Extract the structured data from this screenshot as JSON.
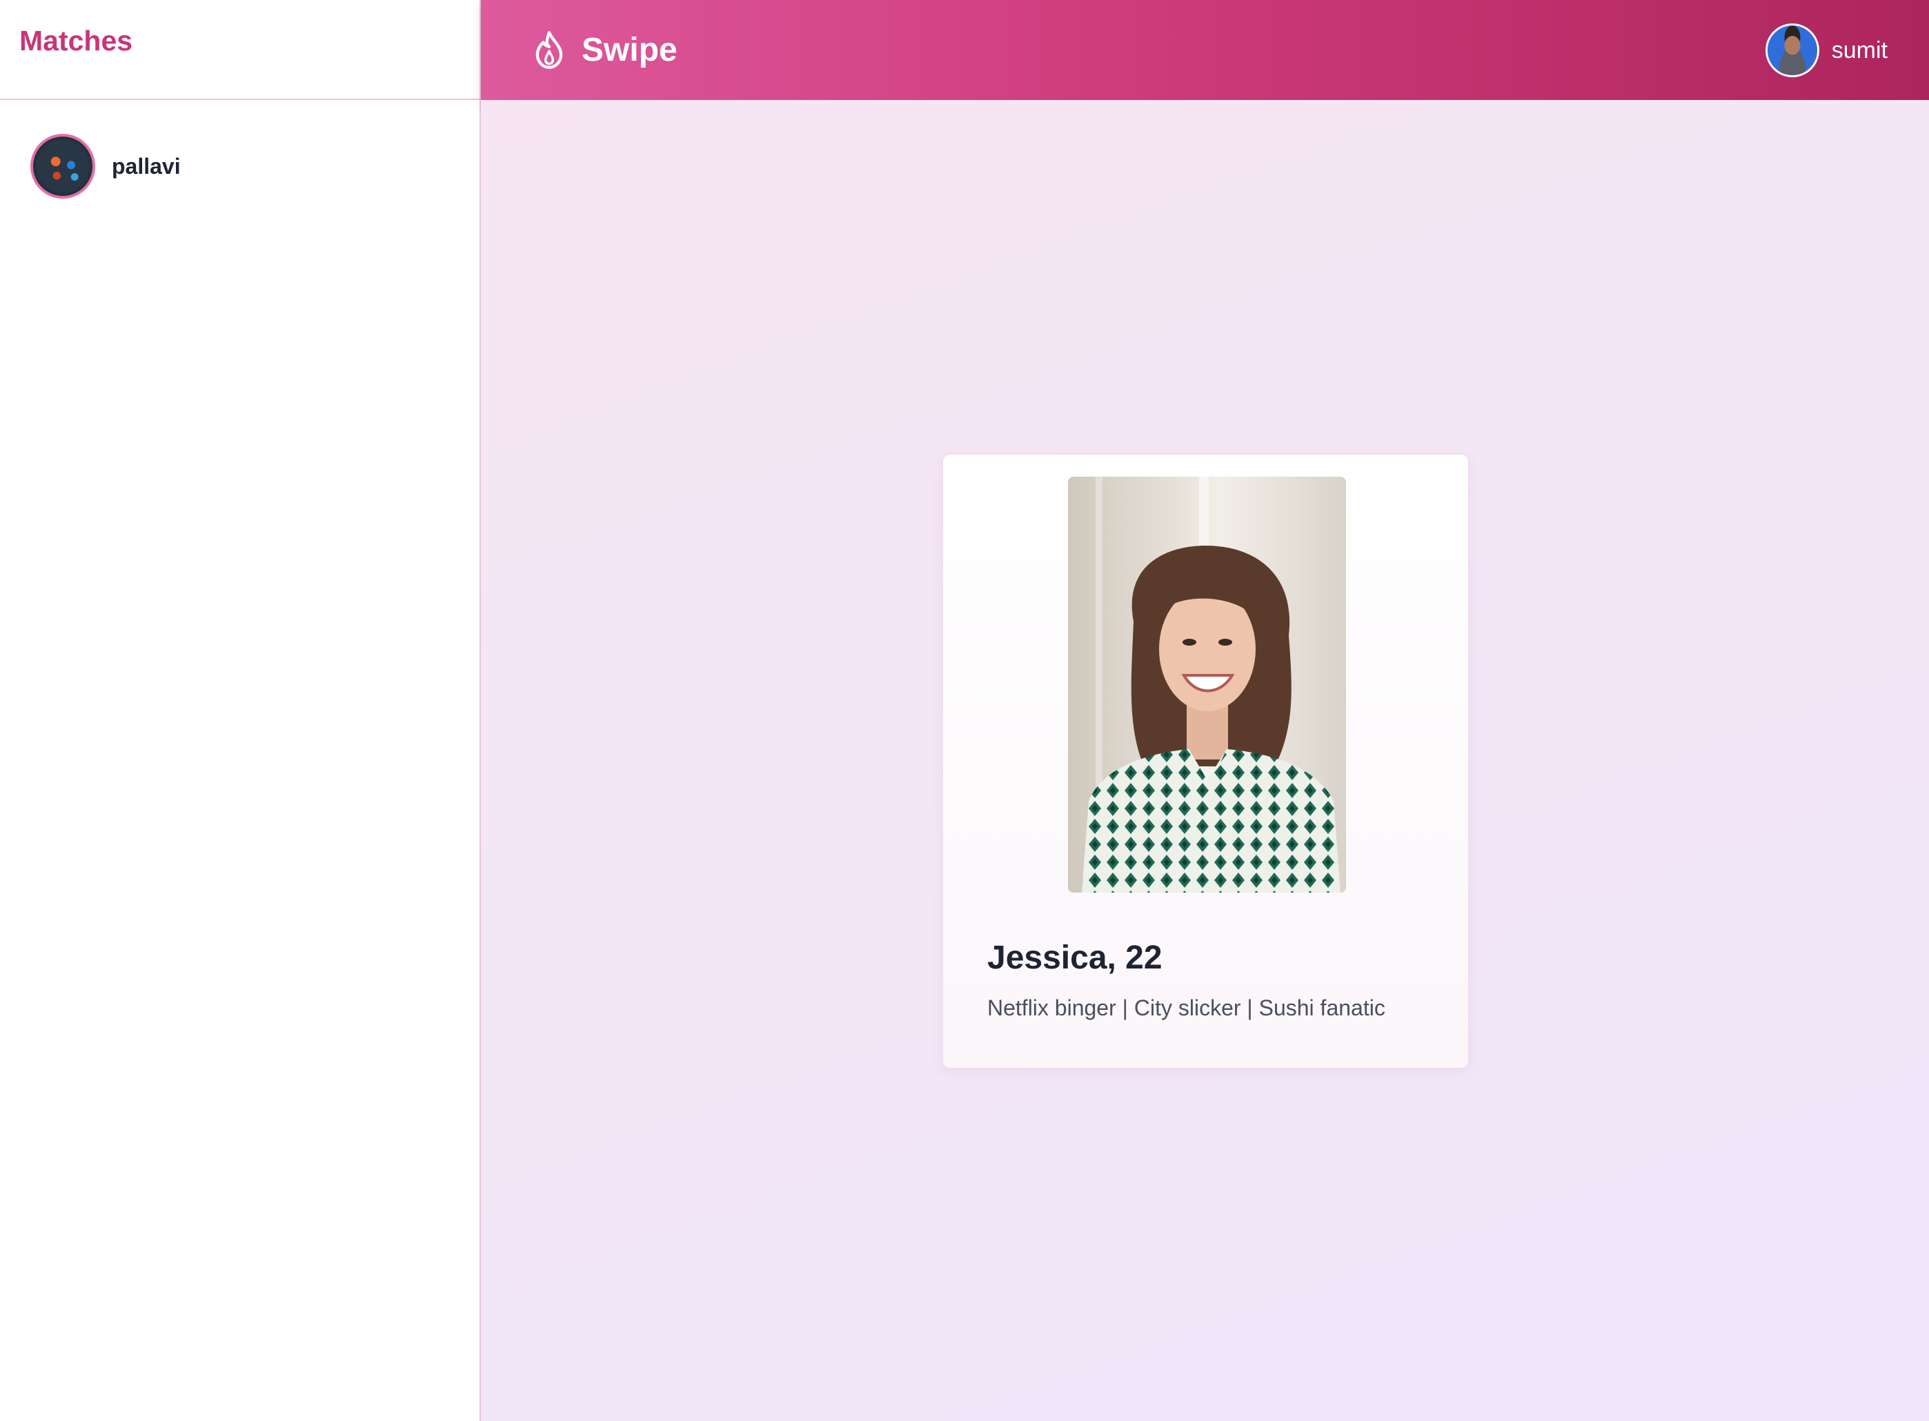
{
  "sidebar": {
    "title": "Matches",
    "matches": [
      {
        "name": "pallavi"
      }
    ]
  },
  "header": {
    "brand": "Swipe",
    "user": {
      "name": "sumit"
    }
  },
  "profile_card": {
    "name_age": "Jessica, 22",
    "bio": "Netflix binger | City slicker | Sushi fanatic"
  },
  "colors": {
    "accent": "#c8357a",
    "header_gradient_start": "#dd5a9d",
    "header_gradient_end": "#ad255e",
    "main_background": "#f4e6f5"
  },
  "icons": {
    "brand": "flame-icon"
  }
}
